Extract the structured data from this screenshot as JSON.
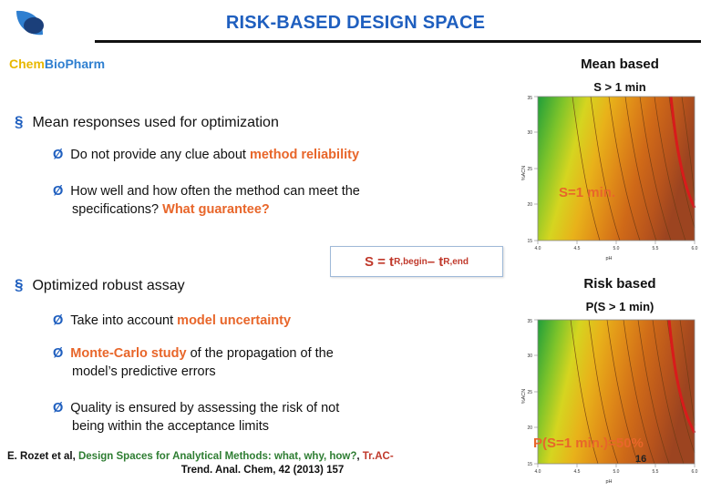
{
  "header": {
    "title": "RISK-BASED DESIGN SPACE",
    "brand_part1": "Chem",
    "brand_part2": "Bio",
    "brand_part3": "Pharm"
  },
  "content": {
    "bullet1": "Mean responses used for optimization",
    "sub1a_prefix": "Do not provide any clue about ",
    "sub1a_highlight": "method reliability",
    "sub1b_line1": "How well and how often the method can meet the",
    "sub1b_line2_prefix": "specifications? ",
    "sub1b_line2_highlight": "What guarantee?",
    "bullet2": "Optimized robust assay",
    "sub2a_prefix": "Take into account ",
    "sub2a_highlight": "model uncertainty",
    "sub2b_highlight": "Monte-Carlo study",
    "sub2b_rest": " of the propagation of the",
    "sub2b_line2": "model’s predictive errors",
    "sub2c_line1": "Quality is ensured by assessing the risk of not",
    "sub2c_line2": "being within the acceptance limits",
    "formula": "S = tR,begin – tR,end",
    "formula_main": "S = t",
    "formula_sub1": "R,begin",
    "formula_mid": " – t",
    "formula_sub2": "R,end"
  },
  "panels": {
    "top_title": "Mean based",
    "top_subtitle": "S > 1 min",
    "top_overlay": "S=1 min.",
    "bottom_title": "Risk based",
    "bottom_subtitle": "P(S > 1 min)",
    "bottom_overlay": "P(S=1 min.)=50%"
  },
  "plots": {
    "top": {
      "ylabel": "%ACN",
      "xlabel": "pH",
      "xticks": [
        "4.0",
        "4.5",
        "5.0",
        "5.5",
        "6.0"
      ],
      "yticks": [
        "15",
        "20",
        "25",
        "30",
        "35"
      ]
    },
    "bottom": {
      "ylabel": "%ACN",
      "xlabel": "pH",
      "xticks": [
        "4.0",
        "4.5",
        "5.0",
        "5.5",
        "6.0"
      ],
      "yticks": [
        "15",
        "20",
        "25",
        "30",
        "35"
      ]
    }
  },
  "footer": {
    "authors": "E. Rozet et al, ",
    "title_green": "Design Spaces for Analytical Methods: what, why, how?",
    "comma": ", ",
    "journal_red": "Tr.AC-",
    "journal_line2": "Trend. Anal. Chem, 42 (2013) 157",
    "page_number": "16"
  },
  "colors": {
    "title_blue": "#1f5fbf",
    "orange": "#e8662a",
    "red": "#c0392b",
    "green": "#2e7d32",
    "brand_yellow": "#e8b800"
  }
}
